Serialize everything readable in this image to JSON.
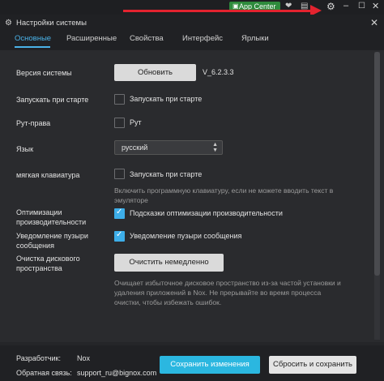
{
  "titlebar": {
    "app_center_label": "App Center",
    "icons": [
      "heart-icon",
      "gift-icon",
      "gear-icon",
      "minimize-icon",
      "maximize-icon",
      "close-icon"
    ]
  },
  "header": {
    "title": "Настройки системы",
    "tabs": [
      {
        "label": "Основные",
        "active": true
      },
      {
        "label": "Расширенные",
        "active": false
      },
      {
        "label": "Свойства",
        "active": false
      },
      {
        "label": "Интерфейс",
        "active": false
      },
      {
        "label": "Ярлыки",
        "active": false
      }
    ]
  },
  "settings": {
    "version_label": "Версия системы",
    "update_button": "Обновить",
    "version_value": "V_6.2.3.3",
    "autostart_label": "Запускать при старте",
    "autostart_option": "Запускать при старте",
    "autostart_checked": false,
    "root_label": "Рут-права",
    "root_option": "Рут",
    "root_checked": false,
    "language_label": "Язык",
    "language_value": "русский",
    "softkb_label": "мягкая клавиатура",
    "softkb_option": "Запускать при старте",
    "softkb_checked": false,
    "softkb_hint_1": "Включить программную клавиатуру, если не можете вводить текст в",
    "softkb_hint_2": "эмуляторе",
    "perf_label_1": "Оптимизации",
    "perf_label_2": "производительности",
    "perf_option": "Подсказки оптимизации производительности",
    "perf_checked": true,
    "bubble_label_1": "Уведомление пузыри",
    "bubble_label_2": "сообщения",
    "bubble_option": "Уведомление пузыри сообщения",
    "bubble_checked": true,
    "disk_label_1": "Очистка дискового",
    "disk_label_2": "пространства",
    "disk_button": "Очистить немедленно",
    "disk_hint_1": "Очищает избыточное дисковое пространство из-за частой установки и",
    "disk_hint_2": "удаления приложений в Nox. Не прерывайте во время процесса",
    "disk_hint_3": "очистки, чтобы избежать ошибок."
  },
  "footer": {
    "developer_label": "Разработчик:",
    "developer_value": "Nox",
    "feedback_label": "Обратная связь:",
    "feedback_value": "support_ru@bignox.com",
    "save_button": "Сохранить изменения",
    "reset_button": "Сбросить и сохранить"
  },
  "colors": {
    "accent": "#3daee9",
    "save_button": "#2bb7e0",
    "app_center": "#2e8b3c",
    "annotation_arrow": "#e3232f"
  }
}
